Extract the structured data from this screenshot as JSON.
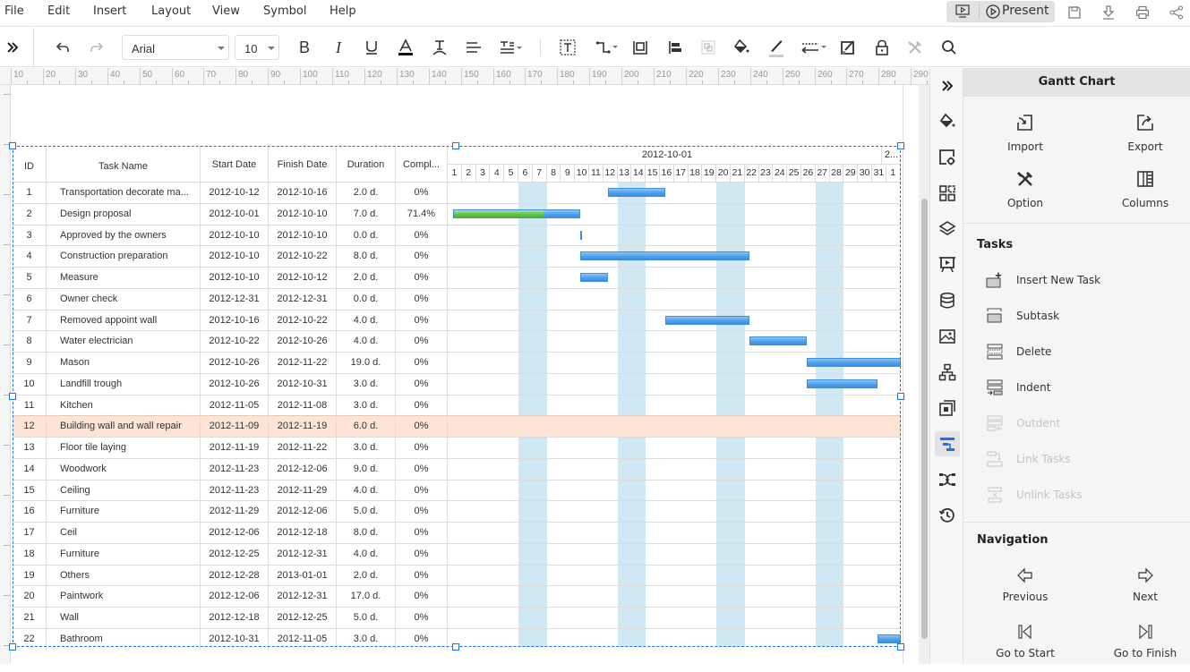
{
  "menubar": {
    "items": [
      "File",
      "Edit",
      "Insert",
      "Layout",
      "View",
      "Symbol",
      "Help"
    ],
    "present_label": "Present",
    "right_icons": [
      "presentation-mode-icon",
      "save-icon",
      "download-icon",
      "print-icon",
      "share-icon"
    ]
  },
  "toolbar": {
    "font_family": "Arial",
    "font_size": "10",
    "icons": [
      "expand-icon",
      "undo-icon",
      "redo-icon",
      "bold-icon",
      "italic-icon",
      "underline-icon",
      "font-color-icon",
      "text-path-icon",
      "align-icon",
      "text-spacing-icon",
      "text-box-icon",
      "connector-icon",
      "container-icon",
      "align-left-icon",
      "group-icon",
      "fill-icon",
      "line-color-icon",
      "line-style-icon",
      "edit-shape-icon",
      "lock-icon",
      "tools-icon",
      "search-icon"
    ]
  },
  "ruler": {
    "labels": [
      "10",
      "20",
      "30",
      "40",
      "50",
      "60",
      "70",
      "80",
      "90",
      "100",
      "110",
      "120",
      "130",
      "140",
      "150",
      "160",
      "170",
      "180",
      "190",
      "200",
      "210",
      "220",
      "230",
      "240",
      "250",
      "260",
      "270",
      "280",
      "290"
    ]
  },
  "gantt": {
    "columns": [
      "ID",
      "Task Name",
      "Start Date",
      "Finish Date",
      "Duration",
      "Compl..."
    ],
    "month_label": "2012-10-01",
    "next_month_label": "2...",
    "days": [
      "1",
      "2",
      "3",
      "4",
      "5",
      "6",
      "7",
      "8",
      "9",
      "10",
      "11",
      "12",
      "13",
      "14",
      "15",
      "16",
      "17",
      "18",
      "19",
      "20",
      "21",
      "22",
      "23",
      "24",
      "25",
      "26",
      "27",
      "28",
      "29",
      "30",
      "31",
      "1"
    ],
    "weekend_days": [
      6,
      7,
      13,
      14,
      20,
      21,
      27,
      28
    ],
    "timeline_start": "2012-10-01",
    "selected_row_id": "12",
    "colors": {
      "bar": "#4ea1ea",
      "progress": "#62c24b",
      "weekend": "#cfe8f4",
      "selected_row": "#fde4d5",
      "selection": "#1a73e8"
    },
    "tasks": [
      {
        "id": "1",
        "name": "Transportation decorate ma...",
        "start": "2012-10-12",
        "finish": "2012-10-16",
        "duration": "2.0 d.",
        "complete": "0%",
        "bar_start_day": 12,
        "bar_end_day": 16,
        "progress": 0
      },
      {
        "id": "2",
        "name": "Design proposal",
        "start": "2012-10-01",
        "finish": "2012-10-10",
        "duration": "7.0 d.",
        "complete": "71.4%",
        "bar_start_day": 1,
        "bar_end_day": 10,
        "progress": 0.714
      },
      {
        "id": "3",
        "name": "Approved by the owners",
        "start": "2012-10-10",
        "finish": "2012-10-10",
        "duration": "0.0 d.",
        "complete": "0%",
        "bar_start_day": 10,
        "bar_end_day": 10,
        "progress": 0
      },
      {
        "id": "4",
        "name": "Construction preparation",
        "start": "2012-10-10",
        "finish": "2012-10-22",
        "duration": "8.0 d.",
        "complete": "0%",
        "bar_start_day": 10,
        "bar_end_day": 22,
        "progress": 0
      },
      {
        "id": "5",
        "name": "Measure",
        "start": "2012-10-10",
        "finish": "2012-10-12",
        "duration": "2.0 d.",
        "complete": "0%",
        "bar_start_day": 10,
        "bar_end_day": 12,
        "progress": 0
      },
      {
        "id": "6",
        "name": "Owner check",
        "start": "2012-12-31",
        "finish": "2012-12-31",
        "duration": "0.0 d.",
        "complete": "0%",
        "bar_start_day": null,
        "bar_end_day": null,
        "progress": 0
      },
      {
        "id": "7",
        "name": "Removed appoint wall",
        "start": "2012-10-16",
        "finish": "2012-10-22",
        "duration": "4.0 d.",
        "complete": "0%",
        "bar_start_day": 16,
        "bar_end_day": 22,
        "progress": 0
      },
      {
        "id": "8",
        "name": "Water electrician",
        "start": "2012-10-22",
        "finish": "2012-10-26",
        "duration": "4.0 d.",
        "complete": "0%",
        "bar_start_day": 22,
        "bar_end_day": 26,
        "progress": 0
      },
      {
        "id": "9",
        "name": "Mason",
        "start": "2012-10-26",
        "finish": "2012-11-22",
        "duration": "19.0 d.",
        "complete": "0%",
        "bar_start_day": 26,
        "bar_end_day": 33,
        "progress": 0
      },
      {
        "id": "10",
        "name": "Landfill trough",
        "start": "2012-10-26",
        "finish": "2012-10-31",
        "duration": "3.0 d.",
        "complete": "0%",
        "bar_start_day": 26,
        "bar_end_day": 31,
        "progress": 0
      },
      {
        "id": "11",
        "name": "Kitchen",
        "start": "2012-11-05",
        "finish": "2012-11-08",
        "duration": "3.0 d.",
        "complete": "0%",
        "bar_start_day": null,
        "bar_end_day": null,
        "progress": 0
      },
      {
        "id": "12",
        "name": "Building wall and wall repair",
        "start": "2012-11-09",
        "finish": "2012-11-19",
        "duration": "6.0 d.",
        "complete": "0%",
        "bar_start_day": null,
        "bar_end_day": null,
        "progress": 0
      },
      {
        "id": "13",
        "name": "Floor tile laying",
        "start": "2012-11-19",
        "finish": "2012-11-22",
        "duration": "3.0 d.",
        "complete": "0%",
        "bar_start_day": null,
        "bar_end_day": null,
        "progress": 0
      },
      {
        "id": "14",
        "name": "Woodwork",
        "start": "2012-11-23",
        "finish": "2012-12-06",
        "duration": "9.0 d.",
        "complete": "0%",
        "bar_start_day": null,
        "bar_end_day": null,
        "progress": 0
      },
      {
        "id": "15",
        "name": "Ceiling",
        "start": "2012-11-23",
        "finish": "2012-11-29",
        "duration": "4.0 d.",
        "complete": "0%",
        "bar_start_day": null,
        "bar_end_day": null,
        "progress": 0
      },
      {
        "id": "16",
        "name": "Furniture",
        "start": "2012-11-29",
        "finish": "2012-12-06",
        "duration": "5.0 d.",
        "complete": "0%",
        "bar_start_day": null,
        "bar_end_day": null,
        "progress": 0
      },
      {
        "id": "17",
        "name": "Ceil",
        "start": "2012-12-06",
        "finish": "2012-12-18",
        "duration": "8.0 d.",
        "complete": "0%",
        "bar_start_day": null,
        "bar_end_day": null,
        "progress": 0
      },
      {
        "id": "18",
        "name": "Furniture",
        "start": "2012-12-25",
        "finish": "2012-12-31",
        "duration": "4.0 d.",
        "complete": "0%",
        "bar_start_day": null,
        "bar_end_day": null,
        "progress": 0
      },
      {
        "id": "19",
        "name": "Others",
        "start": "2012-12-28",
        "finish": "2013-01-01",
        "duration": "2.0 d.",
        "complete": "0%",
        "bar_start_day": null,
        "bar_end_day": null,
        "progress": 0
      },
      {
        "id": "20",
        "name": "Paintwork",
        "start": "2012-12-06",
        "finish": "2012-12-31",
        "duration": "17.0 d.",
        "complete": "0%",
        "bar_start_day": null,
        "bar_end_day": null,
        "progress": 0
      },
      {
        "id": "21",
        "name": "Wall",
        "start": "2012-12-18",
        "finish": "2012-12-25",
        "duration": "5.0 d.",
        "complete": "0%",
        "bar_start_day": null,
        "bar_end_day": null,
        "progress": 0
      },
      {
        "id": "22",
        "name": "Bathroom",
        "start": "2012-10-31",
        "finish": "2012-11-05",
        "duration": "3.0 d.",
        "complete": "0%",
        "bar_start_day": 31,
        "bar_end_day": 33,
        "progress": 0
      }
    ]
  },
  "side_toolbar": {
    "icons": [
      "collapse-panel-icon",
      "fill-icon",
      "shape-settings-icon",
      "grid-icon",
      "layers-icon",
      "presentation-icon",
      "database-icon",
      "image-icon",
      "org-chart-icon",
      "page-icon",
      "gantt-icon",
      "mind-map-icon",
      "history-icon"
    ],
    "active": "gantt-icon"
  },
  "panel": {
    "title": "Gantt Chart",
    "top_buttons": [
      {
        "label": "Import",
        "icon": "import-icon"
      },
      {
        "label": "Export",
        "icon": "export-icon"
      },
      {
        "label": "Option",
        "icon": "option-icon"
      },
      {
        "label": "Columns",
        "icon": "columns-icon"
      }
    ],
    "tasks_heading": "Tasks",
    "task_actions": [
      {
        "label": "Insert New Task",
        "enabled": true
      },
      {
        "label": "Subtask",
        "enabled": true
      },
      {
        "label": "Delete",
        "enabled": true
      },
      {
        "label": "Indent",
        "enabled": true
      },
      {
        "label": "Outdent",
        "enabled": false
      },
      {
        "label": "Link Tasks",
        "enabled": false
      },
      {
        "label": "Unlink Tasks",
        "enabled": false
      }
    ],
    "navigation_heading": "Navigation",
    "nav_buttons": [
      {
        "label": "Previous",
        "icon": "previous-icon"
      },
      {
        "label": "Next",
        "icon": "next-icon"
      },
      {
        "label": "Go to Start",
        "icon": "go-to-start-icon"
      },
      {
        "label": "Go to Finish",
        "icon": "go-to-finish-icon"
      }
    ]
  }
}
